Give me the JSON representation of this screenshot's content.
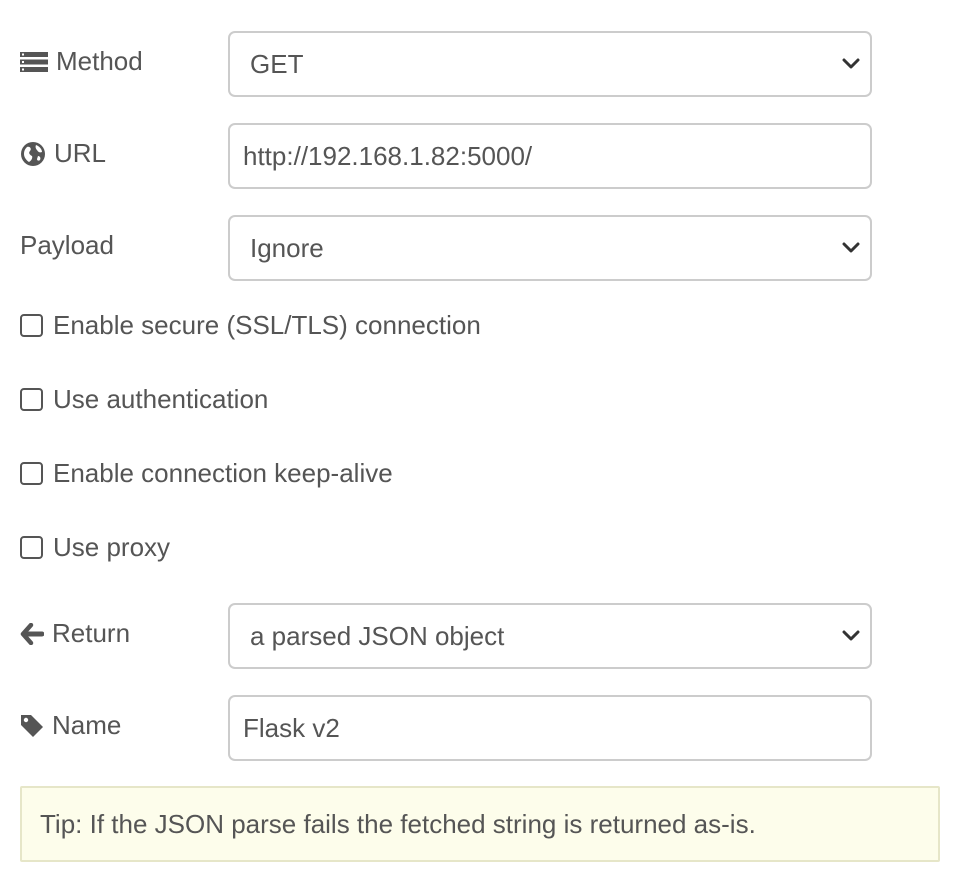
{
  "form": {
    "method": {
      "label": "Method",
      "icon": "list-icon",
      "value": "GET"
    },
    "url": {
      "label": "URL",
      "icon": "globe-icon",
      "value": "http://192.168.1.82:5000/"
    },
    "payload": {
      "label": "Payload",
      "value": "Ignore"
    },
    "checkboxes": [
      {
        "label": "Enable secure (SSL/TLS) connection",
        "checked": false
      },
      {
        "label": "Use authentication",
        "checked": false
      },
      {
        "label": "Enable connection keep-alive",
        "checked": false
      },
      {
        "label": "Use proxy",
        "checked": false
      }
    ],
    "return": {
      "label": "Return",
      "icon": "arrow-left-icon",
      "value": "a parsed JSON object"
    },
    "name": {
      "label": "Name",
      "icon": "tag-icon",
      "value": "Flask v2"
    }
  },
  "tip": {
    "text": "Tip: If the JSON parse fails the fetched string is returned as-is."
  },
  "colors": {
    "text": "#555555",
    "border": "#cccccc",
    "tip_background": "#fdfdeb",
    "tip_border": "#e6e6c8"
  }
}
